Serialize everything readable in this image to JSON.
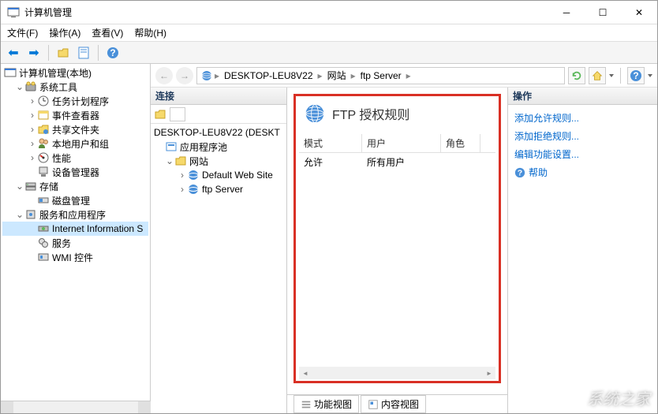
{
  "window": {
    "title": "计算机管理"
  },
  "menubar": {
    "file": "文件(F)",
    "action": "操作(A)",
    "view": "查看(V)",
    "help": "帮助(H)"
  },
  "left_tree": {
    "root": "计算机管理(本地)",
    "system_tools": "系统工具",
    "task_scheduler": "任务计划程序",
    "event_viewer": "事件查看器",
    "shared_folders": "共享文件夹",
    "local_users": "本地用户和组",
    "performance": "性能",
    "device_manager": "设备管理器",
    "storage": "存储",
    "disk_mgmt": "磁盘管理",
    "services_apps": "服务和应用程序",
    "iis": "Internet Information S",
    "services": "服务",
    "wmi": "WMI 控件"
  },
  "breadcrumb": {
    "seg1": "DESKTOP-LEU8V22",
    "seg2": "网站",
    "seg3": "ftp Server"
  },
  "connections": {
    "header": "连接",
    "root": "DESKTOP-LEU8V22 (DESKT",
    "app_pools": "应用程序池",
    "sites": "网站",
    "default_site": "Default Web Site",
    "ftp_server": "ftp Server"
  },
  "feature": {
    "title": "FTP 授权规则",
    "col_mode": "模式",
    "col_user": "用户",
    "col_role": "角色",
    "row1_mode": "允许",
    "row1_user": "所有用户"
  },
  "view_tabs": {
    "feature": "功能视图",
    "content": "内容视图"
  },
  "actions": {
    "header": "操作",
    "add_allow": "添加允许规则...",
    "add_deny": "添加拒绝规则...",
    "edit_feature": "编辑功能设置...",
    "help": "帮助"
  },
  "watermark": "系统之家"
}
